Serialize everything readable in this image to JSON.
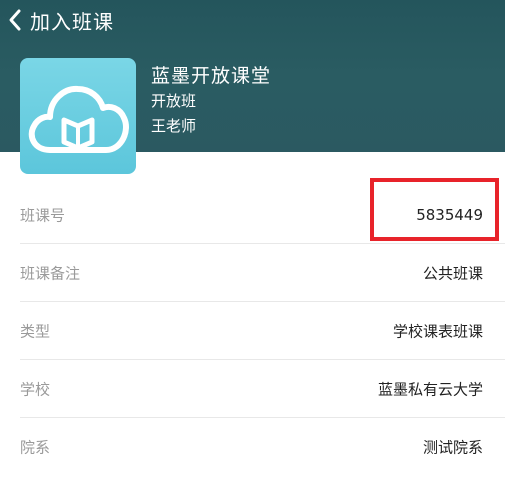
{
  "nav": {
    "back_icon": "chevron-left-icon",
    "title": "加入班课"
  },
  "course": {
    "cover_icon": "cloud-book-icon",
    "name": "蓝墨开放课堂",
    "class_type": "开放班",
    "teacher": "王老师"
  },
  "details": [
    {
      "label": "班课号",
      "value": "5835449"
    },
    {
      "label": "班课备注",
      "value": "公共班课"
    },
    {
      "label": "类型",
      "value": "学校课表班课"
    },
    {
      "label": "学校",
      "value": "蓝墨私有云大学"
    },
    {
      "label": "院系",
      "value": "测试院系"
    }
  ],
  "colors": {
    "header_bg": "#2a5c62",
    "cover_bg": "#62c9dd",
    "highlight": "#e8232a",
    "label": "#9a9a9a",
    "value": "#222222"
  }
}
